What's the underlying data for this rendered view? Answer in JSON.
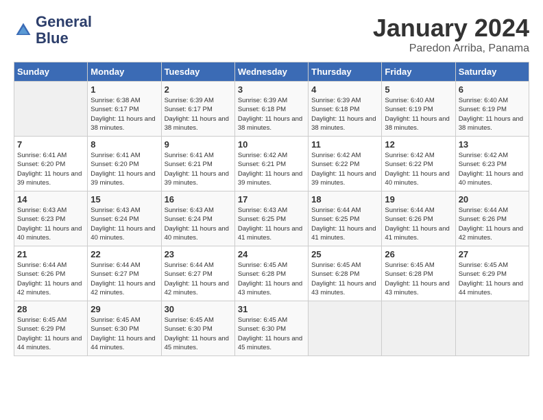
{
  "logo": {
    "line1": "General",
    "line2": "Blue"
  },
  "title": "January 2024",
  "location": "Paredon Arriba, Panama",
  "days_of_week": [
    "Sunday",
    "Monday",
    "Tuesday",
    "Wednesday",
    "Thursday",
    "Friday",
    "Saturday"
  ],
  "weeks": [
    [
      {
        "day": "",
        "sunrise": "",
        "sunset": "",
        "daylight": ""
      },
      {
        "day": "1",
        "sunrise": "Sunrise: 6:38 AM",
        "sunset": "Sunset: 6:17 PM",
        "daylight": "Daylight: 11 hours and 38 minutes."
      },
      {
        "day": "2",
        "sunrise": "Sunrise: 6:39 AM",
        "sunset": "Sunset: 6:17 PM",
        "daylight": "Daylight: 11 hours and 38 minutes."
      },
      {
        "day": "3",
        "sunrise": "Sunrise: 6:39 AM",
        "sunset": "Sunset: 6:18 PM",
        "daylight": "Daylight: 11 hours and 38 minutes."
      },
      {
        "day": "4",
        "sunrise": "Sunrise: 6:39 AM",
        "sunset": "Sunset: 6:18 PM",
        "daylight": "Daylight: 11 hours and 38 minutes."
      },
      {
        "day": "5",
        "sunrise": "Sunrise: 6:40 AM",
        "sunset": "Sunset: 6:19 PM",
        "daylight": "Daylight: 11 hours and 38 minutes."
      },
      {
        "day": "6",
        "sunrise": "Sunrise: 6:40 AM",
        "sunset": "Sunset: 6:19 PM",
        "daylight": "Daylight: 11 hours and 38 minutes."
      }
    ],
    [
      {
        "day": "7",
        "sunrise": "Sunrise: 6:41 AM",
        "sunset": "Sunset: 6:20 PM",
        "daylight": "Daylight: 11 hours and 39 minutes."
      },
      {
        "day": "8",
        "sunrise": "Sunrise: 6:41 AM",
        "sunset": "Sunset: 6:20 PM",
        "daylight": "Daylight: 11 hours and 39 minutes."
      },
      {
        "day": "9",
        "sunrise": "Sunrise: 6:41 AM",
        "sunset": "Sunset: 6:21 PM",
        "daylight": "Daylight: 11 hours and 39 minutes."
      },
      {
        "day": "10",
        "sunrise": "Sunrise: 6:42 AM",
        "sunset": "Sunset: 6:21 PM",
        "daylight": "Daylight: 11 hours and 39 minutes."
      },
      {
        "day": "11",
        "sunrise": "Sunrise: 6:42 AM",
        "sunset": "Sunset: 6:22 PM",
        "daylight": "Daylight: 11 hours and 39 minutes."
      },
      {
        "day": "12",
        "sunrise": "Sunrise: 6:42 AM",
        "sunset": "Sunset: 6:22 PM",
        "daylight": "Daylight: 11 hours and 40 minutes."
      },
      {
        "day": "13",
        "sunrise": "Sunrise: 6:42 AM",
        "sunset": "Sunset: 6:23 PM",
        "daylight": "Daylight: 11 hours and 40 minutes."
      }
    ],
    [
      {
        "day": "14",
        "sunrise": "Sunrise: 6:43 AM",
        "sunset": "Sunset: 6:23 PM",
        "daylight": "Daylight: 11 hours and 40 minutes."
      },
      {
        "day": "15",
        "sunrise": "Sunrise: 6:43 AM",
        "sunset": "Sunset: 6:24 PM",
        "daylight": "Daylight: 11 hours and 40 minutes."
      },
      {
        "day": "16",
        "sunrise": "Sunrise: 6:43 AM",
        "sunset": "Sunset: 6:24 PM",
        "daylight": "Daylight: 11 hours and 40 minutes."
      },
      {
        "day": "17",
        "sunrise": "Sunrise: 6:43 AM",
        "sunset": "Sunset: 6:25 PM",
        "daylight": "Daylight: 11 hours and 41 minutes."
      },
      {
        "day": "18",
        "sunrise": "Sunrise: 6:44 AM",
        "sunset": "Sunset: 6:25 PM",
        "daylight": "Daylight: 11 hours and 41 minutes."
      },
      {
        "day": "19",
        "sunrise": "Sunrise: 6:44 AM",
        "sunset": "Sunset: 6:26 PM",
        "daylight": "Daylight: 11 hours and 41 minutes."
      },
      {
        "day": "20",
        "sunrise": "Sunrise: 6:44 AM",
        "sunset": "Sunset: 6:26 PM",
        "daylight": "Daylight: 11 hours and 42 minutes."
      }
    ],
    [
      {
        "day": "21",
        "sunrise": "Sunrise: 6:44 AM",
        "sunset": "Sunset: 6:26 PM",
        "daylight": "Daylight: 11 hours and 42 minutes."
      },
      {
        "day": "22",
        "sunrise": "Sunrise: 6:44 AM",
        "sunset": "Sunset: 6:27 PM",
        "daylight": "Daylight: 11 hours and 42 minutes."
      },
      {
        "day": "23",
        "sunrise": "Sunrise: 6:44 AM",
        "sunset": "Sunset: 6:27 PM",
        "daylight": "Daylight: 11 hours and 42 minutes."
      },
      {
        "day": "24",
        "sunrise": "Sunrise: 6:45 AM",
        "sunset": "Sunset: 6:28 PM",
        "daylight": "Daylight: 11 hours and 43 minutes."
      },
      {
        "day": "25",
        "sunrise": "Sunrise: 6:45 AM",
        "sunset": "Sunset: 6:28 PM",
        "daylight": "Daylight: 11 hours and 43 minutes."
      },
      {
        "day": "26",
        "sunrise": "Sunrise: 6:45 AM",
        "sunset": "Sunset: 6:28 PM",
        "daylight": "Daylight: 11 hours and 43 minutes."
      },
      {
        "day": "27",
        "sunrise": "Sunrise: 6:45 AM",
        "sunset": "Sunset: 6:29 PM",
        "daylight": "Daylight: 11 hours and 44 minutes."
      }
    ],
    [
      {
        "day": "28",
        "sunrise": "Sunrise: 6:45 AM",
        "sunset": "Sunset: 6:29 PM",
        "daylight": "Daylight: 11 hours and 44 minutes."
      },
      {
        "day": "29",
        "sunrise": "Sunrise: 6:45 AM",
        "sunset": "Sunset: 6:30 PM",
        "daylight": "Daylight: 11 hours and 44 minutes."
      },
      {
        "day": "30",
        "sunrise": "Sunrise: 6:45 AM",
        "sunset": "Sunset: 6:30 PM",
        "daylight": "Daylight: 11 hours and 45 minutes."
      },
      {
        "day": "31",
        "sunrise": "Sunrise: 6:45 AM",
        "sunset": "Sunset: 6:30 PM",
        "daylight": "Daylight: 11 hours and 45 minutes."
      },
      {
        "day": "",
        "sunrise": "",
        "sunset": "",
        "daylight": ""
      },
      {
        "day": "",
        "sunrise": "",
        "sunset": "",
        "daylight": ""
      },
      {
        "day": "",
        "sunrise": "",
        "sunset": "",
        "daylight": ""
      }
    ]
  ]
}
